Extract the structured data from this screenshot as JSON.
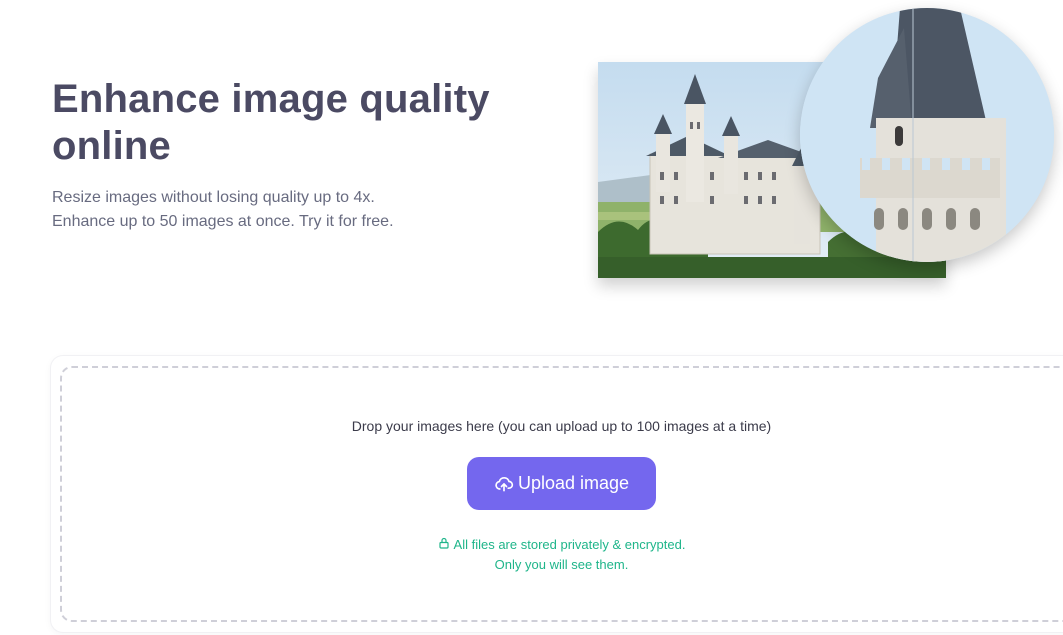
{
  "hero": {
    "title": "Enhance image quality online",
    "subtitle_line1": "Resize images without losing quality up to 4x.",
    "subtitle_line2": "Enhance up to 50 images at once. Try it for free."
  },
  "upload": {
    "drop_text": "Drop your images here (you can upload up to 100 images at a time)",
    "button_label": "Upload image",
    "privacy_line1": "All files are stored privately & encrypted.",
    "privacy_line2": "Only you will see them."
  },
  "icons": {
    "upload": "cloud-upload-icon",
    "privacy": "lock-icon"
  },
  "colors": {
    "accent": "#7467ee",
    "privacy_text": "#1fb58a",
    "title_text": "#4b4a63"
  }
}
